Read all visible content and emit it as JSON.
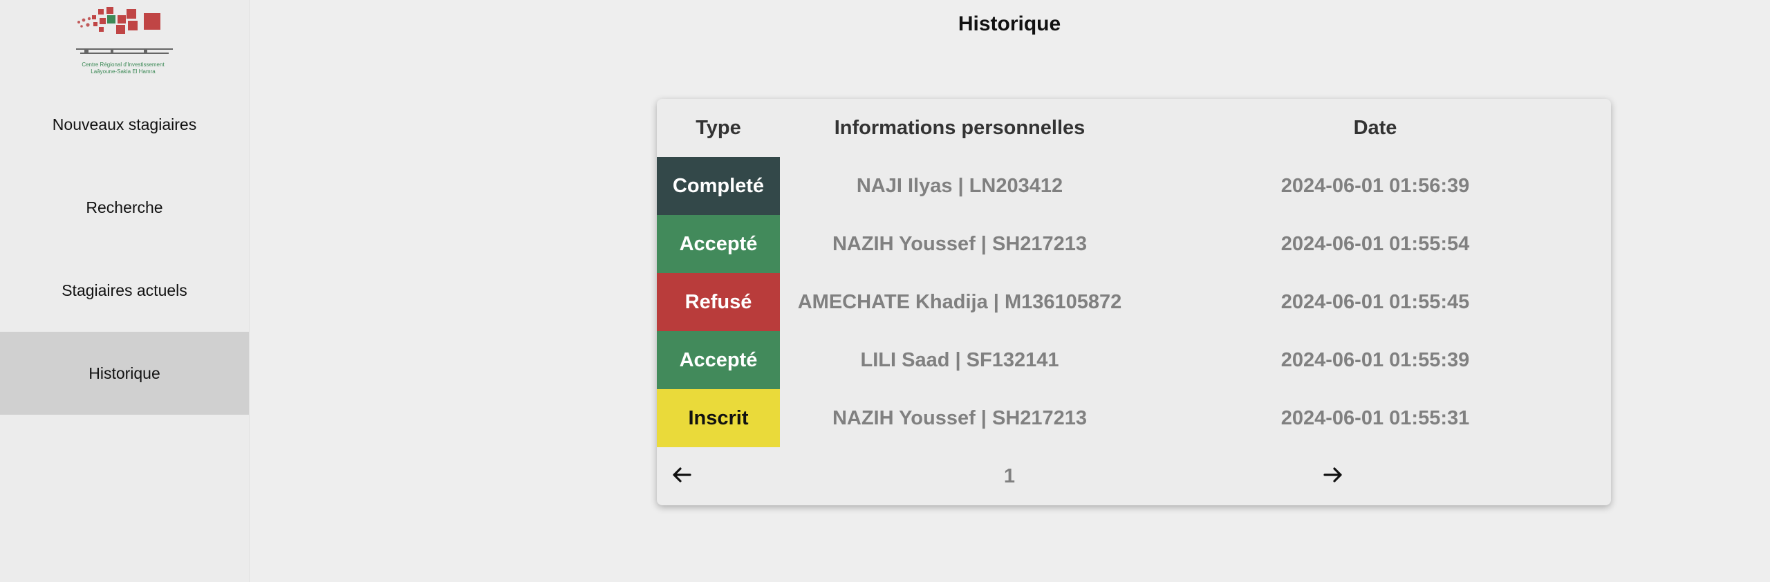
{
  "logo": {
    "alt": "Centre Régional d'Investissement Laâyoune-Sakia El Hamra",
    "text_line1": "Centre Régional d'Investissement",
    "text_line2": "Laâyoune-Sakia El Hamra"
  },
  "sidebar": {
    "items": [
      {
        "label": "Nouveaux stagiaires",
        "active": false
      },
      {
        "label": "Recherche",
        "active": false
      },
      {
        "label": "Stagiaires actuels",
        "active": false
      },
      {
        "label": "Historique",
        "active": true
      }
    ]
  },
  "page": {
    "title": "Historique"
  },
  "table": {
    "headers": {
      "type": "Type",
      "info": "Informations personnelles",
      "date": "Date"
    },
    "rows": [
      {
        "type": "Completé",
        "info": "NAJI Ilyas | LN203412",
        "date": "2024-06-01 01:56:39",
        "color": "#334849"
      },
      {
        "type": "Accepté",
        "info": "NAZIH Youssef | SH217213",
        "date": "2024-06-01 01:55:54",
        "color": "#428a5b"
      },
      {
        "type": "Refusé",
        "info": "AMECHATE Khadija | M136105872",
        "date": "2024-06-01 01:55:45",
        "color": "#b93c3b"
      },
      {
        "type": "Accepté",
        "info": "LILI Saad | SF132141",
        "date": "2024-06-01 01:55:39",
        "color": "#428a5b"
      },
      {
        "type": "Inscrit",
        "info": "NAZIH Youssef | SH217213",
        "date": "2024-06-01 01:55:31",
        "color": "#eada3a"
      }
    ]
  },
  "pagination": {
    "page": "1",
    "prev_icon": "arrow-left-icon",
    "next_icon": "arrow-right-icon"
  },
  "colors": {
    "background": "#eeeeee",
    "active_nav": "#d0d0d0",
    "muted_text": "#808080"
  }
}
